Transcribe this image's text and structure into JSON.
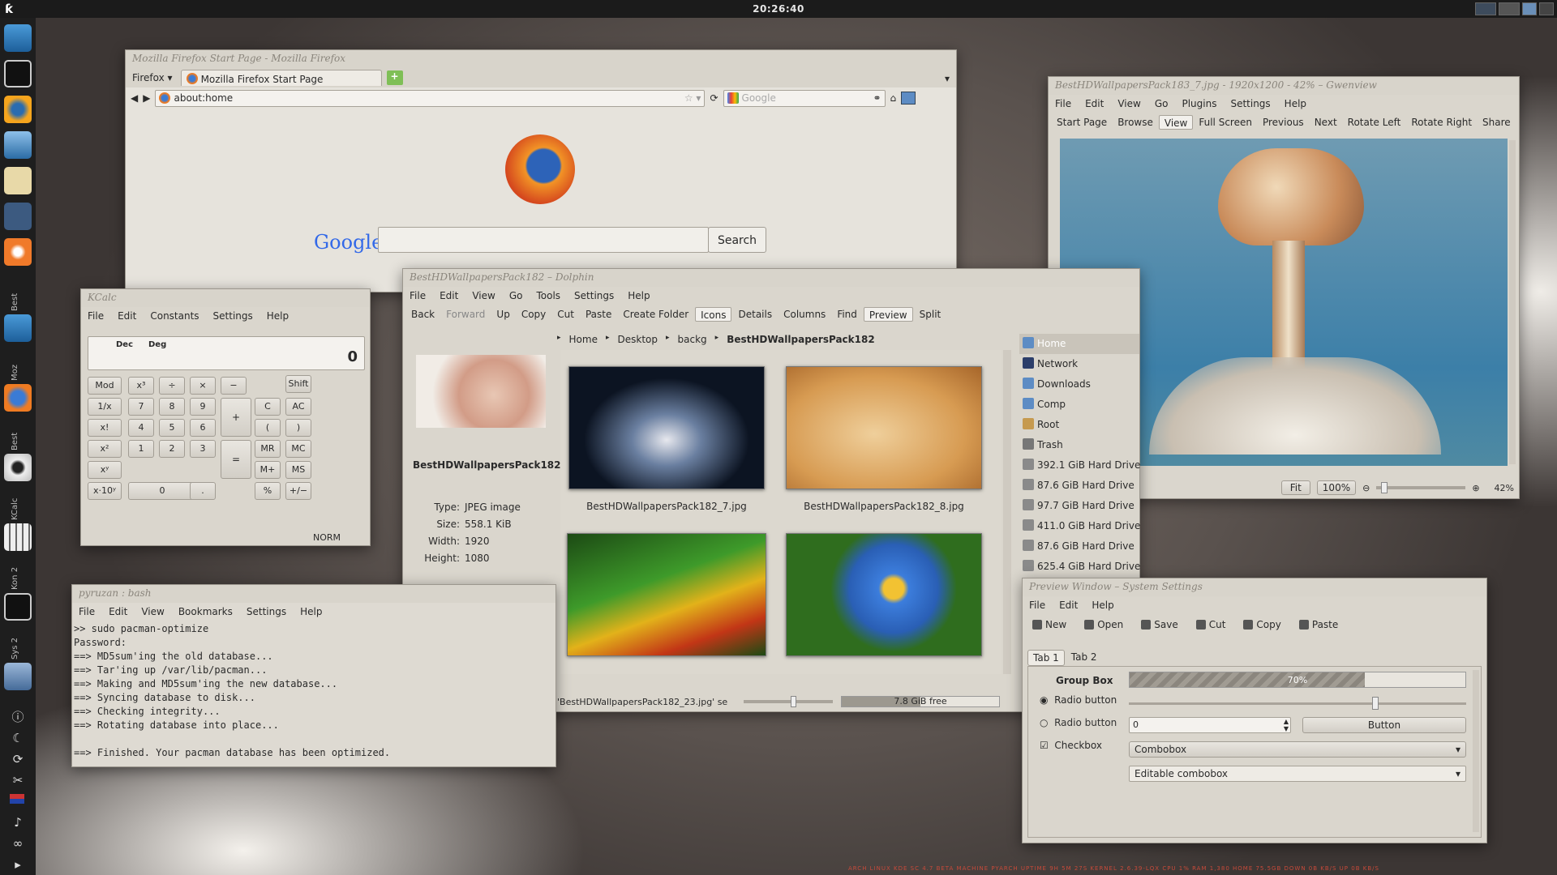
{
  "clock": "20:26:40",
  "firefox": {
    "title": "Mozilla Firefox Start Page - Mozilla Firefox",
    "menu_btn": "Firefox",
    "tab": "Mozilla Firefox Start Page",
    "url": "about:home",
    "search_engine_placeholder": "Google",
    "google_logo": "Google",
    "search_button": "Search"
  },
  "dolphin": {
    "title": "BestHDWallpapersPack182 – Dolphin",
    "menu": [
      "File",
      "Edit",
      "View",
      "Go",
      "Tools",
      "Settings",
      "Help"
    ],
    "toolbar": [
      "Back",
      "Forward",
      "Up",
      "Copy",
      "Cut",
      "Paste",
      "Create Folder",
      "Icons",
      "Details",
      "Columns",
      "Find",
      "Preview",
      "Split"
    ],
    "breadcrumb": [
      "Home",
      "Desktop",
      "backg",
      "BestHDWallpapersPack182"
    ],
    "preview_name": "BestHDWallpapersPack182_23.jpg",
    "info": [
      {
        "k": "Type:",
        "v": "JPEG image"
      },
      {
        "k": "Size:",
        "v": "558.1 KiB"
      },
      {
        "k": "Width:",
        "v": "1920"
      },
      {
        "k": "Height:",
        "v": "1080"
      }
    ],
    "files": [
      "BestHDWallpapersPack182_7.jpg",
      "BestHDWallpapersPack182_8.jpg"
    ],
    "places": [
      "Home",
      "Network",
      "Downloads",
      "Comp",
      "Root",
      "Trash",
      "392.1 GiB Hard Drive",
      "87.6 GiB Hard Drive",
      "97.7 GiB Hard Drive",
      "411.0 GiB Hard Drive",
      "87.6 GiB Hard Drive",
      "625.4 GiB Hard Drive"
    ],
    "status": "'BestHDWallpapersPack182_23.jpg' se",
    "free": "7.8 GiB free"
  },
  "kcalc": {
    "title": "KCalc",
    "menu": [
      "File",
      "Edit",
      "Constants",
      "Settings",
      "Help"
    ],
    "mode1": "Dec",
    "mode2": "Deg",
    "display": "0",
    "mode": "NORM",
    "keys": {
      "mod": "Mod",
      "inv": "1/x",
      "fact": "x!",
      "sq": "x²",
      "pow": "xʸ",
      "exp": "x·10ʸ",
      "cube": "x³",
      "div": "÷",
      "mul": "×",
      "minus": "−",
      "plus": "+",
      "eq": "=",
      "shift": "Shift",
      "c": "C",
      "ac": "AC",
      "lp": "(",
      "rp": ")",
      "mr": "MR",
      "mc": "MC",
      "mplus": "M+",
      "ms": "MS",
      "pct": "%",
      "pm": "+/−",
      "dot": ".",
      "n0": "0",
      "n1": "1",
      "n2": "2",
      "n3": "3",
      "n4": "4",
      "n5": "5",
      "n6": "6",
      "n7": "7",
      "n8": "8",
      "n9": "9"
    }
  },
  "konsole": {
    "title": "pyruzan : bash",
    "menu": [
      "File",
      "Edit",
      "View",
      "Bookmarks",
      "Settings",
      "Help"
    ],
    "lines": [
      ">> sudo pacman-optimize",
      "Password:",
      "==> MD5sum'ing the old database...",
      "==> Tar'ing up /var/lib/pacman...",
      "==> Making and MD5sum'ing the new database...",
      "==> Syncing database to disk...",
      "==> Checking integrity...",
      "==> Rotating database into place...",
      "",
      "==> Finished. Your pacman database has been optimized."
    ]
  },
  "gwenview": {
    "title": "BestHDWallpapersPack183_7.jpg - 1920x1200 - 42% – Gwenview",
    "menu": [
      "File",
      "Edit",
      "View",
      "Go",
      "Plugins",
      "Settings",
      "Help"
    ],
    "toolbar": [
      "Start Page",
      "Browse",
      "View",
      "Full Screen",
      "Previous",
      "Next",
      "Rotate Left",
      "Rotate Right",
      "Share"
    ],
    "fit": "Fit",
    "zoom100": "100%",
    "zoom": "42%"
  },
  "settings": {
    "title": "Preview Window – System Settings",
    "menu": [
      "File",
      "Edit",
      "Help"
    ],
    "toolbar": [
      "New",
      "Open",
      "Save",
      "Cut",
      "Copy",
      "Paste"
    ],
    "tabs": [
      "Tab 1",
      "Tab 2"
    ],
    "group": "Group Box",
    "progress": 70,
    "progress_label": "70%",
    "radio1": "Radio button",
    "radio2": "Radio button",
    "checkbox": "Checkbox",
    "spin": "0",
    "button": "Button",
    "combo": "Combobox",
    "editcombo": "Editable combobox",
    "slider": 0.72
  },
  "statusbar": "ARCH LINUX  KDE SC 4.7 BETA  MACHINE PYARCH  UPTIME 9H 5M 27S  KERNEL 2.6.39-LQX  CPU 1%  RAM 1,380  HOME 75.5GB  DOWN 0B KB/S  UP 0B KB/S"
}
